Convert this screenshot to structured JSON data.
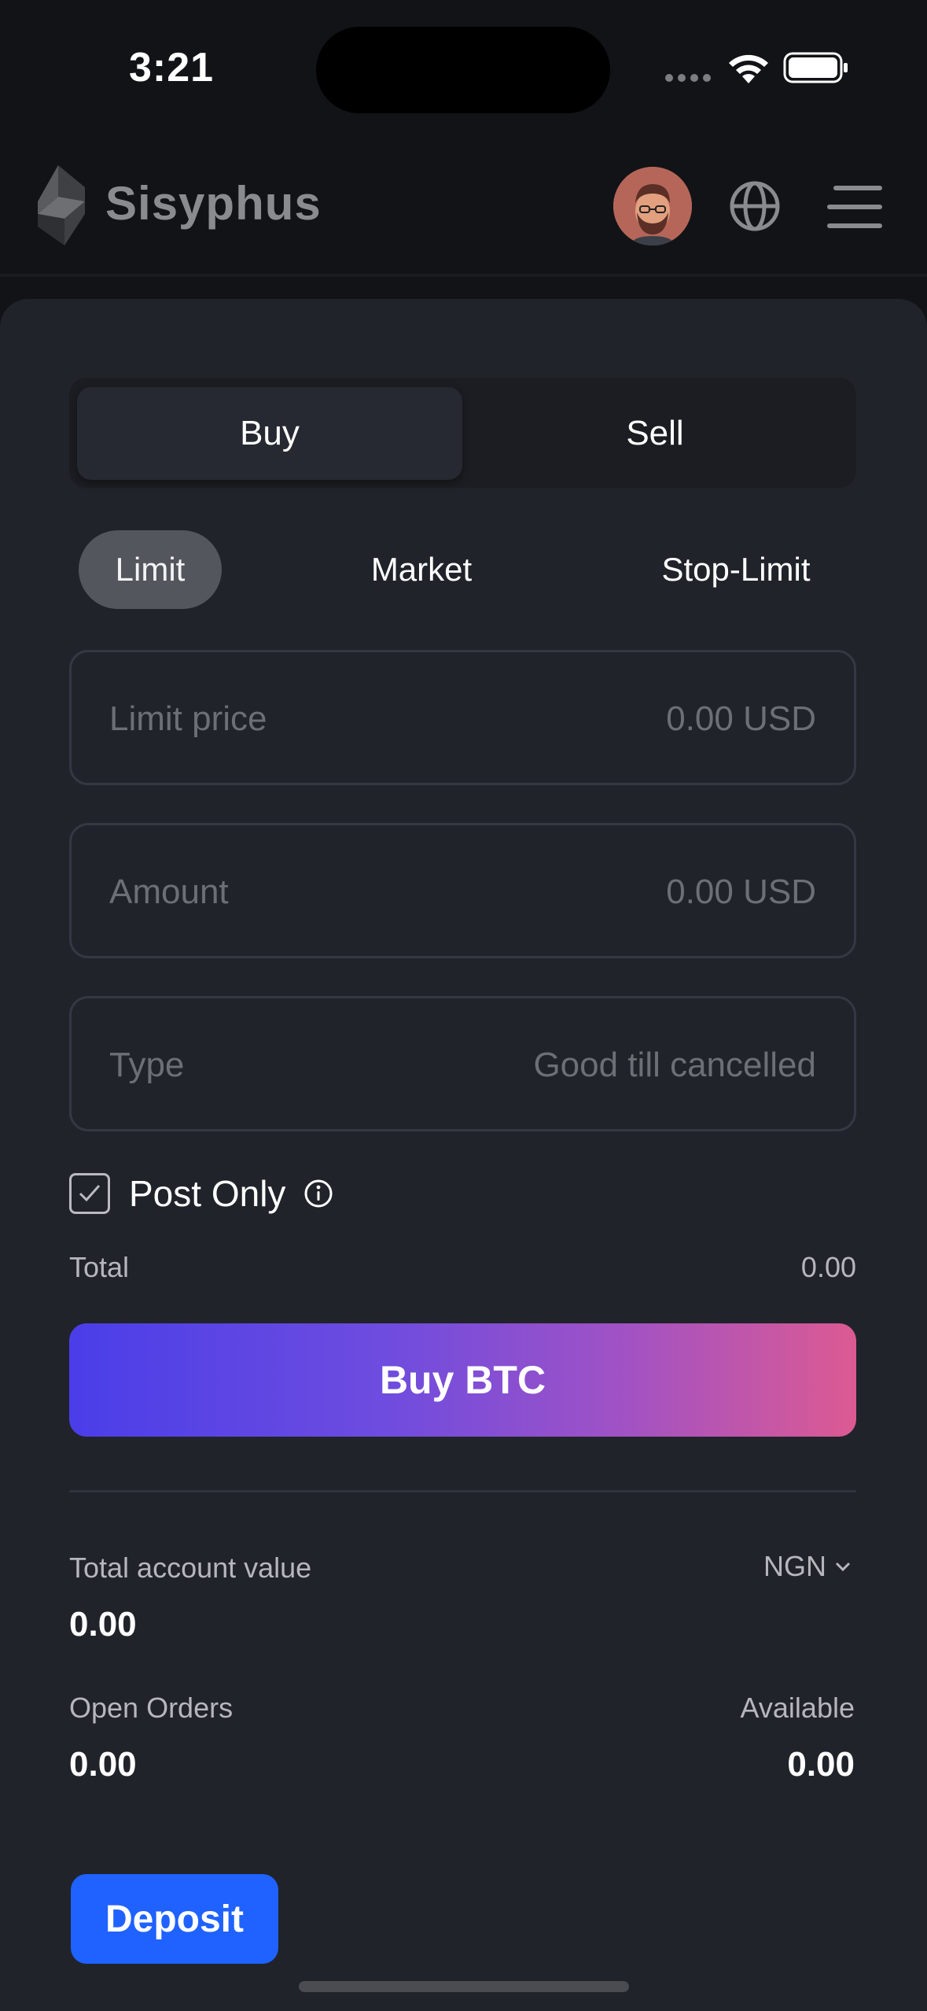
{
  "status_bar": {
    "time": "3:21"
  },
  "header": {
    "brand": "Sisyphus"
  },
  "trade": {
    "side_tabs": {
      "buy": "Buy",
      "sell": "Sell",
      "active": "Buy"
    },
    "order_types": {
      "limit": "Limit",
      "market": "Market",
      "stop_limit": "Stop-Limit",
      "active": "Limit"
    },
    "fields": {
      "limit_price": {
        "label": "Limit price",
        "value": "0.00 USD"
      },
      "amount": {
        "label": "Amount",
        "value": "0.00 USD"
      },
      "type": {
        "label": "Type",
        "value": "Good till cancelled"
      }
    },
    "post_only": {
      "label": "Post Only",
      "checked": true
    },
    "total": {
      "label": "Total",
      "value": "0.00"
    },
    "submit_label": "Buy BTC"
  },
  "account": {
    "total_value_label": "Total account value",
    "currency": "NGN",
    "total_value": "0.00",
    "open_orders_label": "Open Orders",
    "open_orders": "0.00",
    "available_label": "Available",
    "available": "0.00",
    "deposit_label": "Deposit"
  },
  "colors": {
    "background": "#121316",
    "card": "#20232a",
    "deposit": "#1f62ff",
    "gradient_start": "#4a3ee8",
    "gradient_end": "#dc5a92"
  }
}
